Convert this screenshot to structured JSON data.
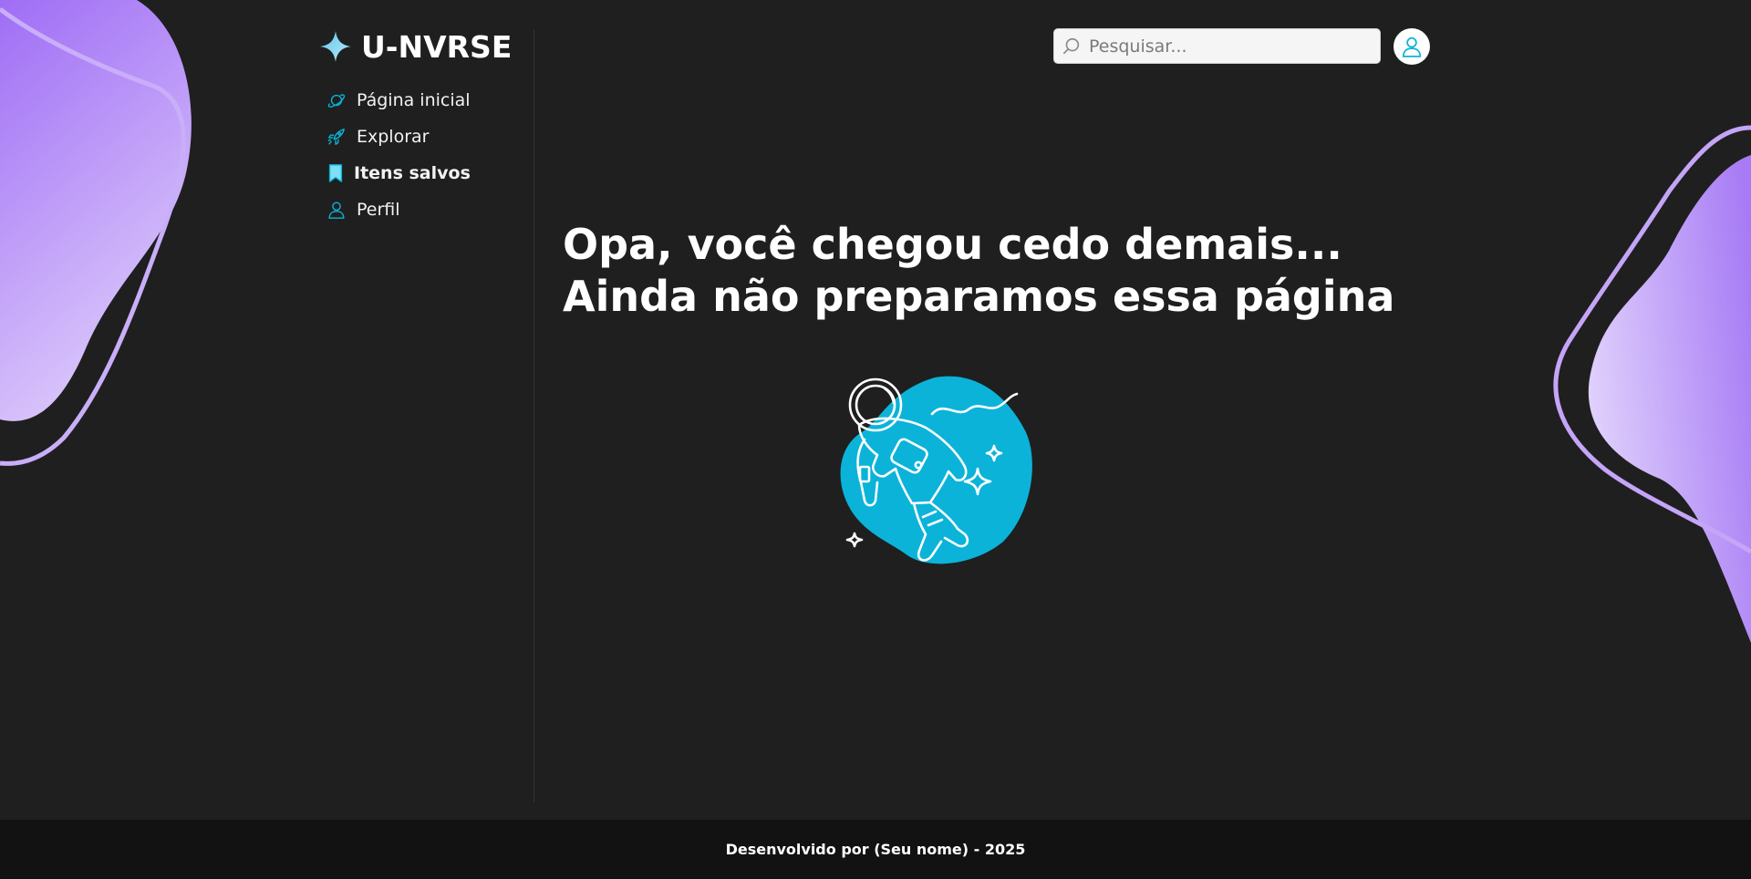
{
  "brand": {
    "name": "U-NVRSE"
  },
  "nav": {
    "items": [
      {
        "label": "Página inicial",
        "icon": "planet-icon",
        "active": false
      },
      {
        "label": "Explorar",
        "icon": "rocket-icon",
        "active": false
      },
      {
        "label": "Itens salvos",
        "icon": "bookmark-icon",
        "active": true
      },
      {
        "label": "Perfil",
        "icon": "user-icon",
        "active": false
      }
    ]
  },
  "search": {
    "placeholder": "Pesquisar...",
    "value": ""
  },
  "main": {
    "headline_line1": "Opa, você chegou cedo demais...",
    "headline_line2": "Ainda não preparamos essa página"
  },
  "footer": {
    "text": "Desenvolvido por (Seu nome) - 2025"
  },
  "colors": {
    "background": "#1f1f1f",
    "accent": "#0bb3d9",
    "blob": "#a77bf5",
    "footer": "#121212"
  }
}
